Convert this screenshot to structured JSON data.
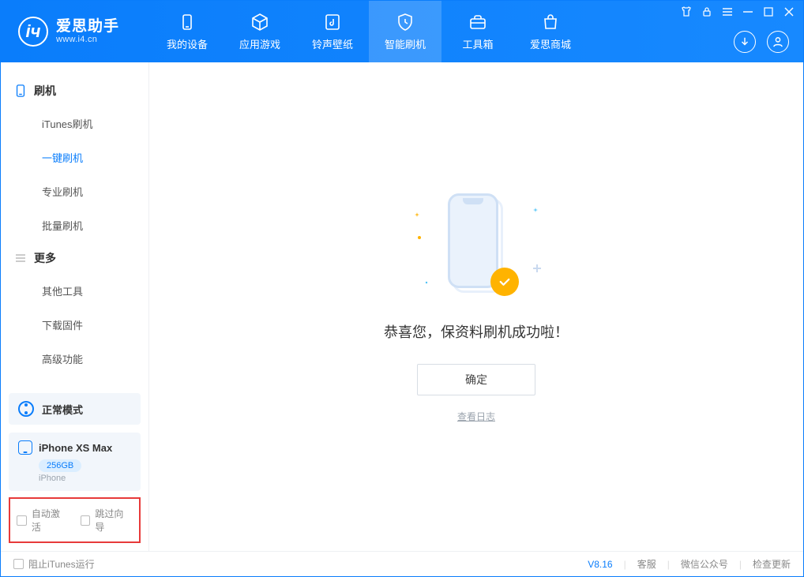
{
  "app": {
    "title": "爱思助手",
    "subtitle": "www.i4.cn"
  },
  "tabs": [
    {
      "label": "我的设备",
      "icon": "device"
    },
    {
      "label": "应用游戏",
      "icon": "cube"
    },
    {
      "label": "铃声壁纸",
      "icon": "music"
    },
    {
      "label": "智能刷机",
      "icon": "shield",
      "active": true
    },
    {
      "label": "工具箱",
      "icon": "toolbox"
    },
    {
      "label": "爱思商城",
      "icon": "bag"
    }
  ],
  "sidebar": {
    "group1": {
      "title": "刷机",
      "items": [
        "iTunes刷机",
        "一键刷机",
        "专业刷机",
        "批量刷机"
      ],
      "active_index": 1
    },
    "group2": {
      "title": "更多",
      "items": [
        "其他工具",
        "下载固件",
        "高级功能"
      ]
    }
  },
  "mode": {
    "label": "正常模式"
  },
  "device": {
    "name": "iPhone XS Max",
    "storage": "256GB",
    "type": "iPhone"
  },
  "checkboxes": {
    "auto_activate": "自动激活",
    "skip_guide": "跳过向导"
  },
  "main": {
    "success_text": "恭喜您，保资料刷机成功啦！",
    "confirm_label": "确定",
    "view_log_label": "查看日志"
  },
  "footer": {
    "stop_itunes": "阻止iTunes运行",
    "version": "V8.16",
    "links": [
      "客服",
      "微信公众号",
      "检查更新"
    ]
  }
}
